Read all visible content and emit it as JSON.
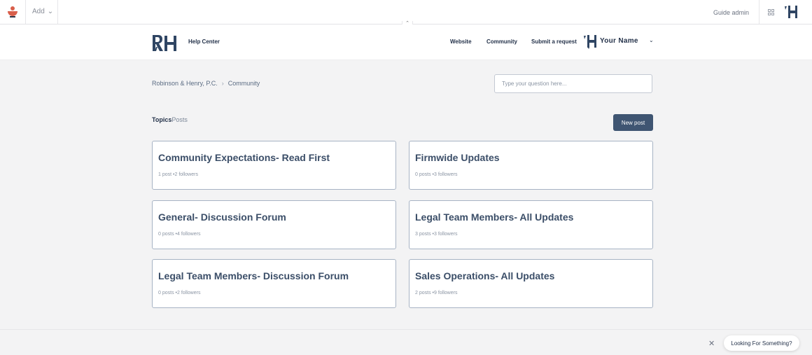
{
  "admin_bar": {
    "add_label": "Add",
    "add_chevron": "⌄",
    "guide_admin_label": "Guide admin"
  },
  "header": {
    "brand": "Help Center",
    "nav": [
      {
        "label": "Website"
      },
      {
        "label": "Community"
      },
      {
        "label": "Submit a request"
      }
    ],
    "user_name": "Your Name",
    "user_chevron": "⌄"
  },
  "breadcrumb": {
    "items": [
      "Robinson & Henry, P.C.",
      "Community"
    ],
    "separator": "›"
  },
  "search": {
    "placeholder": "Type your question here..."
  },
  "tabs": {
    "topics": "Topics",
    "posts": "Posts"
  },
  "new_post_label": "New post",
  "topics": [
    {
      "title": "Community Expectations- Read First",
      "posts": "1 post",
      "followers": "2 followers"
    },
    {
      "title": "Firmwide Updates",
      "posts": "0 posts",
      "followers": "3 followers"
    },
    {
      "title": "General- Discussion Forum",
      "posts": "0 posts",
      "followers": "4 followers"
    },
    {
      "title": "Legal Team Members- All Updates",
      "posts": "3 posts",
      "followers": "3 followers"
    },
    {
      "title": "Legal Team Members- Discussion Forum",
      "posts": "0 posts",
      "followers": "2 followers"
    },
    {
      "title": "Sales Operations- All Updates",
      "posts": "2 posts",
      "followers": "9 followers"
    }
  ],
  "widget": {
    "label": "Looking For Something?",
    "close": "✕"
  },
  "colors": {
    "accent": "#3f5572",
    "brand_red": "#d95f4b",
    "text": "#3b4e68"
  }
}
